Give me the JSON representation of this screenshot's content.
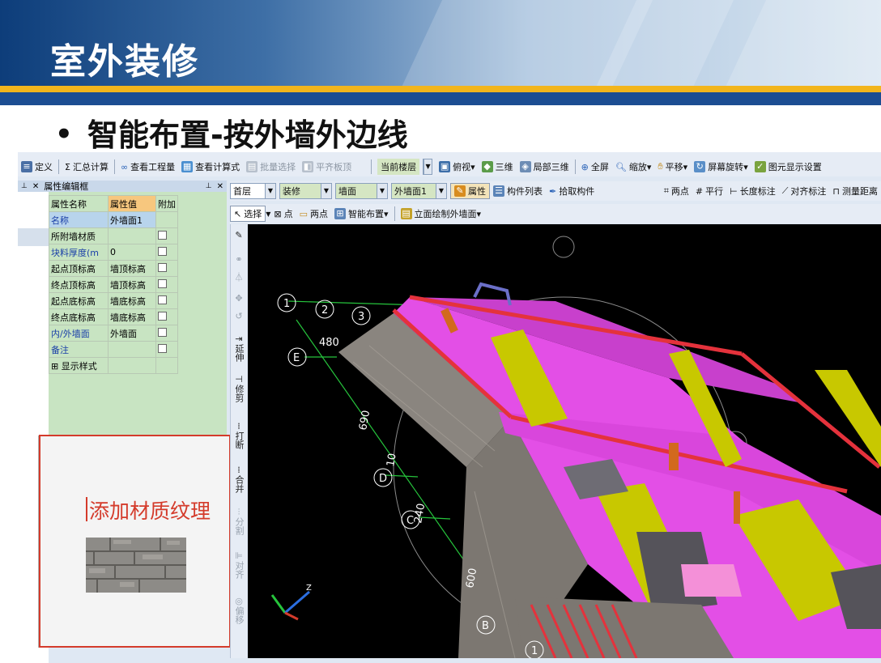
{
  "slide": {
    "title": "室外装修",
    "bullet": "•",
    "subtitle": "智能布置-按外墙外边线"
  },
  "toolbar1": {
    "define": "定义",
    "sum_calc": "汇总计算",
    "view_quantity": "查看工程量",
    "view_formula": "查看计算式",
    "batch_select": "批量选择",
    "align_slab": "平齐板顶",
    "current_floor": "当前楼层",
    "top_view": "俯视",
    "three_d": "三维",
    "local_3d": "局部三维",
    "full_screen": "全屏",
    "zoom": "缩放",
    "pan": "平移",
    "screen_rotate": "屏幕旋转",
    "element_display_settings": "图元显示设置"
  },
  "toolbar2": {
    "floor": "首层",
    "category": "装修",
    "component_type": "墙面",
    "component": "外墙面1",
    "properties": "属性",
    "component_list": "构件列表",
    "pick_component": "拾取构件",
    "two_point": "两点",
    "parallel": "平行",
    "length_dim": "长度标注",
    "align_dim": "对齐标注",
    "measure_dist": "测量距离"
  },
  "toolbar3": {
    "select": "选择",
    "point": "点",
    "two_point": "两点",
    "smart_layout": "智能布置",
    "elevation_draw": "立面绘制外墙面"
  },
  "prop_panel": {
    "title": "属性编辑框",
    "col_name": "属性名称",
    "col_value": "属性值",
    "col_extra": "附加",
    "rows": [
      {
        "name": "名称",
        "value": "外墙面1",
        "blue": true,
        "check": false
      },
      {
        "name": "所附墙材质",
        "value": "",
        "blue": false,
        "check": true
      },
      {
        "name": "块料厚度(m",
        "value": "0",
        "blue": true,
        "check": true
      },
      {
        "name": "起点顶标高",
        "value": "墙顶标高",
        "blue": false,
        "check": true
      },
      {
        "name": "终点顶标高",
        "value": "墙顶标高",
        "blue": false,
        "check": true
      },
      {
        "name": "起点底标高",
        "value": "墙底标高",
        "blue": false,
        "check": true
      },
      {
        "name": "终点底标高",
        "value": "墙底标高",
        "blue": false,
        "check": true
      },
      {
        "name": "内/外墙面",
        "value": "外墙面",
        "blue": true,
        "check": true
      },
      {
        "name": "备注",
        "value": "",
        "blue": true,
        "check": true
      },
      {
        "name": "显示样式",
        "value": "",
        "blue": false,
        "check": false
      }
    ]
  },
  "texture_panel": {
    "label": "添加材质纹理"
  },
  "vertical_tools": {
    "extend": "延伸",
    "trim": "修剪",
    "break": "打断",
    "merge": "合并",
    "split": "分割",
    "align": "对齐",
    "offset": "偏移"
  },
  "viewport": {
    "axis_labels": {
      "a1": "1",
      "a2": "2",
      "a3": "3",
      "e": "E",
      "d": "D",
      "c": "C",
      "b": "B",
      "b1": "1"
    },
    "dimensions": {
      "d480": "480",
      "d690": "690",
      "d10": "10",
      "d240": "240",
      "d600": "600"
    },
    "colors": {
      "wall": "#e34fe6",
      "window": "#c8c800",
      "brick": "#8a857f",
      "red": "#e4323c",
      "dim_line": "#26c43c"
    }
  }
}
